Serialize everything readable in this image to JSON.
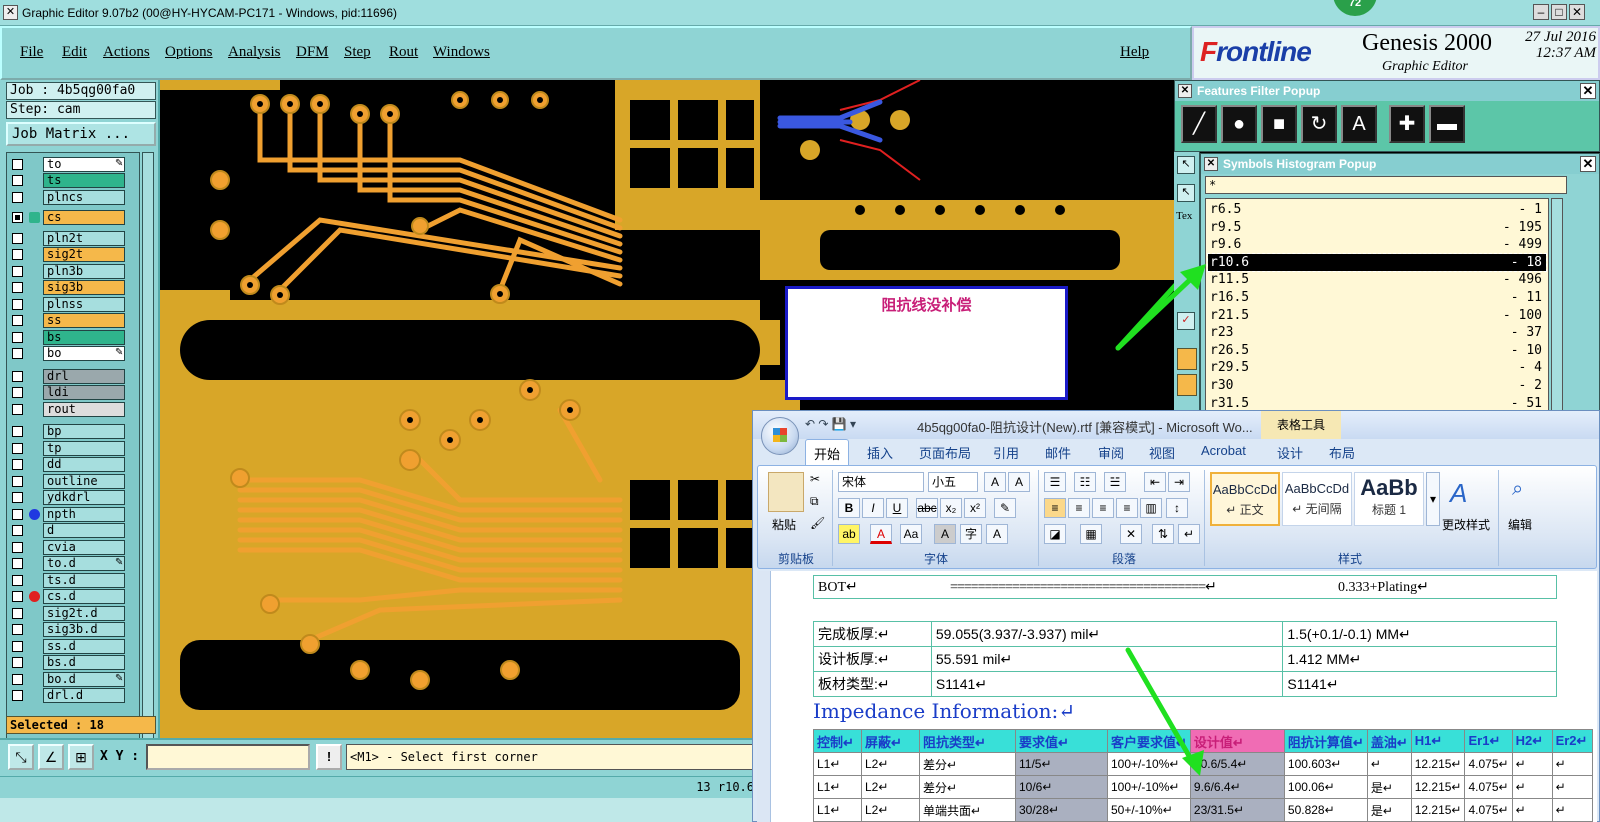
{
  "window": {
    "title": "Graphic Editor 9.07b2 (00@HY-HYCAM-PC171 - Windows, pid:11696)",
    "badge": "72"
  },
  "menu": [
    "File",
    "Edit",
    "Actions",
    "Options",
    "Analysis",
    "DFM",
    "Step",
    "Rout",
    "Windows"
  ],
  "help_label": "Help",
  "logo": {
    "brand_a": "F",
    "brand_b": "rontline",
    "product": "Genesis 2000",
    "subtitle": "Graphic Editor",
    "date": "27 Jul 2016",
    "time": "12:37 AM"
  },
  "left_panel": {
    "job": "Job : 4b5qg00fa0",
    "step": "Step: cam",
    "job_matrix": "Job Matrix ...",
    "selected": "Selected : 18",
    "layers": [
      {
        "name": "to",
        "color": "#ffffff",
        "flag": "✎"
      },
      {
        "name": "ts",
        "color": "#2fb48c"
      },
      {
        "name": "plncs",
        "color": "#a6dede"
      },
      {
        "name": "cs",
        "color": "#f5b84a",
        "active": true
      },
      {
        "name": "pln2t",
        "color": "#a6dede"
      },
      {
        "name": "sig2t",
        "color": "#f5b84a"
      },
      {
        "name": "pln3b",
        "color": "#a6dede"
      },
      {
        "name": "sig3b",
        "color": "#f5b84a"
      },
      {
        "name": "plnss",
        "color": "#a6dede"
      },
      {
        "name": "ss",
        "color": "#f5b84a"
      },
      {
        "name": "bs",
        "color": "#2fb48c"
      },
      {
        "name": "bo",
        "color": "#ffffff",
        "flag": "✎"
      },
      {
        "name": "drl",
        "color": "#9aa8ac"
      },
      {
        "name": "ldi",
        "color": "#9aa8ac"
      },
      {
        "name": "rout",
        "color": "#dddddd"
      },
      {
        "name": "bp",
        "color": "#a6dede"
      },
      {
        "name": "tp",
        "color": "#a6dede"
      },
      {
        "name": "dd",
        "color": "#a6dede"
      },
      {
        "name": "outline",
        "color": "#a6dede"
      },
      {
        "name": "ydkdrl",
        "color": "#a6dede"
      },
      {
        "name": "npth",
        "color": "#a6dede",
        "dot": "#2038e0"
      },
      {
        "name": "d",
        "color": "#a6dede"
      },
      {
        "name": "cvia",
        "color": "#a6dede"
      },
      {
        "name": "to.d",
        "color": "#a6dede",
        "flag": "✎"
      },
      {
        "name": "ts.d",
        "color": "#a6dede"
      },
      {
        "name": "cs.d",
        "color": "#a6dede",
        "dot": "#e02020"
      },
      {
        "name": "sig2t.d",
        "color": "#a6dede"
      },
      {
        "name": "sig3b.d",
        "color": "#a6dede"
      },
      {
        "name": "ss.d",
        "color": "#a6dede"
      },
      {
        "name": "bs.d",
        "color": "#a6dede"
      },
      {
        "name": "bo.d",
        "color": "#a6dede",
        "flag": "✎"
      },
      {
        "name": "drl.d",
        "color": "#a6dede"
      }
    ]
  },
  "bottom": {
    "xy_label": "X Y :",
    "xy_value": "",
    "prompt": "<M1> - Select first corner",
    "status": "13 r10.6"
  },
  "canvas": {
    "note": "阻抗线没补偿"
  },
  "features_filter": {
    "title": "Features Filter Popup"
  },
  "symbols_histogram": {
    "title": "Symbols Histogram Popup",
    "filter": "*",
    "rows": [
      {
        "sym": "r6.5",
        "count": "- 1"
      },
      {
        "sym": "r9.5",
        "count": "- 195"
      },
      {
        "sym": "r9.6",
        "count": "- 499"
      },
      {
        "sym": "r10.6",
        "count": "- 18",
        "selected": true
      },
      {
        "sym": "r11.5",
        "count": "- 496"
      },
      {
        "sym": "r16.5",
        "count": "- 11"
      },
      {
        "sym": "r21.5",
        "count": "- 100"
      },
      {
        "sym": "r23",
        "count": "- 37"
      },
      {
        "sym": "r26.5",
        "count": "- 10"
      },
      {
        "sym": "r29.5",
        "count": "- 4"
      },
      {
        "sym": "r30",
        "count": "- 2"
      },
      {
        "sym": "r31.5",
        "count": "- 51"
      }
    ],
    "side_label": "Tex"
  },
  "word": {
    "title": "4b5qg00fa0-阻抗设计(New).rtf [兼容模式] - Microsoft Wo...",
    "table_tools": "表格工具",
    "tabs": [
      "开始",
      "插入",
      "页面布局",
      "引用",
      "邮件",
      "审阅",
      "视图",
      "Acrobat",
      "设计",
      "布局"
    ],
    "ribbon": {
      "paste": "粘贴",
      "clipboard": "剪贴板",
      "font_name": "宋体",
      "font_size": "小五",
      "font_group": "字体",
      "paragraph_group": "段落",
      "styles_group": "样式",
      "change_styles": "更改样式",
      "edit": "编辑",
      "styles": [
        {
          "sample": "AaBbCcDd",
          "name": "↵ 正文"
        },
        {
          "sample": "AaBbCcDd",
          "name": "↵ 无间隔"
        },
        {
          "sample": "AaBb",
          "name": "标题 1"
        }
      ]
    },
    "doc": {
      "bot_row": {
        "label": "BOT↵",
        "line": "=====================================↵",
        "value": "0.333+Plating↵"
      },
      "info_rows": [
        [
          "完成板厚:↵",
          "59.055(3.937/-3.937) mil↵",
          "1.5(+0.1/-0.1) MM↵"
        ],
        [
          "设计板厚:↵",
          "55.591 mil↵",
          "1.412 MM↵"
        ],
        [
          "板材类型:↵",
          "S1141↵",
          "S1141↵"
        ]
      ],
      "impedance_heading": "Impedance Information:↵",
      "imp_header": [
        "控制↵",
        "屏蔽↵",
        "阻抗类型↵",
        "要求值↵",
        "客户要求值↵",
        "设计值↵",
        "阻抗计算值↵",
        "盖油↵",
        "H1↵",
        "Er1↵",
        "H2↵",
        "Er2↵"
      ],
      "imp_rows": [
        [
          "L1↵",
          "L2↵",
          "差分↵",
          "11/5↵",
          "100+/-10%↵",
          "10.6/5.4↵",
          "100.603↵",
          "↵",
          "12.215↵",
          "4.075↵",
          "↵",
          "↵"
        ],
        [
          "L1↵",
          "L2↵",
          "差分↵",
          "10/6↵",
          "100+/-10%↵",
          "9.6/6.4↵",
          "100.06↵",
          "是↵",
          "12.215↵",
          "4.075↵",
          "↵",
          "↵"
        ],
        [
          "L1↵",
          "L2↵",
          "单端共面↵",
          "30/28↵",
          "50+/-10%↵",
          "23/31.5↵",
          "50.828↵",
          "是↵",
          "12.215↵",
          "4.075↵",
          "↵",
          "↵"
        ]
      ]
    }
  },
  "colors": {
    "copper": "#d8a628",
    "trace": "#f0a030",
    "pad_edge": "#c08a1c",
    "background": "#000000",
    "arrow": "#20e020",
    "highlight_trace": "#3a58e0"
  }
}
